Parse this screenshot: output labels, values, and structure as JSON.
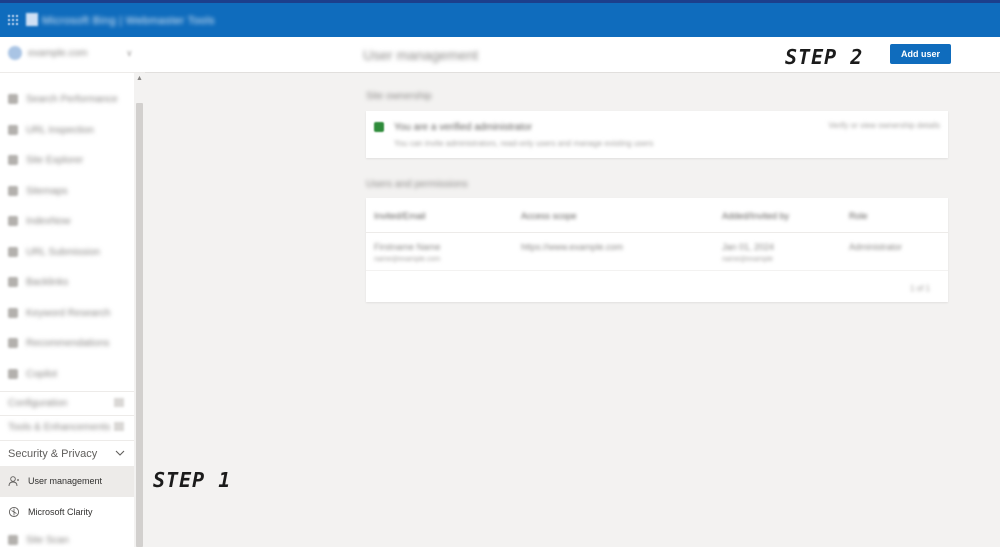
{
  "app": {
    "title": "Microsoft Bing | Webmaster Tools"
  },
  "site": {
    "name": "example.com"
  },
  "sidebar": {
    "items": [
      {
        "label": "Search Performance",
        "icon": "chart-icon"
      },
      {
        "label": "URL Inspection",
        "icon": "search-icon"
      },
      {
        "label": "Site Explorer",
        "icon": "folder-icon"
      },
      {
        "label": "Sitemaps",
        "icon": "sitemap-icon"
      },
      {
        "label": "IndexNow",
        "icon": "index-icon"
      },
      {
        "label": "URL Submission",
        "icon": "upload-icon"
      },
      {
        "label": "Backlinks",
        "icon": "link-icon"
      },
      {
        "label": "Keyword Research",
        "icon": "keyword-icon"
      },
      {
        "label": "Recommendations",
        "icon": "bulb-icon"
      },
      {
        "label": "Copilot",
        "icon": "copilot-icon"
      }
    ],
    "sections": [
      {
        "label": "Configuration"
      },
      {
        "label": "Tools & Enhancements"
      }
    ],
    "security": {
      "label": "Security & Privacy",
      "items": [
        {
          "label": "User management",
          "icon": "user-icon",
          "active": true
        },
        {
          "label": "Microsoft Clarity",
          "icon": "clarity-icon",
          "active": false
        }
      ]
    },
    "extra_item": {
      "label": "Site Scan"
    }
  },
  "header": {
    "title": "User management",
    "add_user_label": "Add user"
  },
  "annotations": {
    "step1": "STEP 1",
    "step2": "STEP 2"
  },
  "ownership": {
    "section_label": "Site ownership",
    "title": "You are a verified administrator",
    "description": "You can invite administrators, read-only users and manage existing users",
    "link": "Verify or view ownership details"
  },
  "users": {
    "section_label": "Users and permissions",
    "columns": [
      "Invited/Email",
      "Access scope",
      "Added/Invited by",
      "Role"
    ],
    "rows": [
      {
        "name": "Firstname Name",
        "email": "name@example.com",
        "scope": "https://www.example.com",
        "added": "Jan 01, 2024",
        "added_sub": "name@example",
        "role": "Administrator"
      }
    ],
    "pager": "1 of 1"
  },
  "colors": {
    "topbar": "#0f6cbd",
    "accent": "#0f6cbd",
    "owner_badge": "#2e8b3a"
  }
}
